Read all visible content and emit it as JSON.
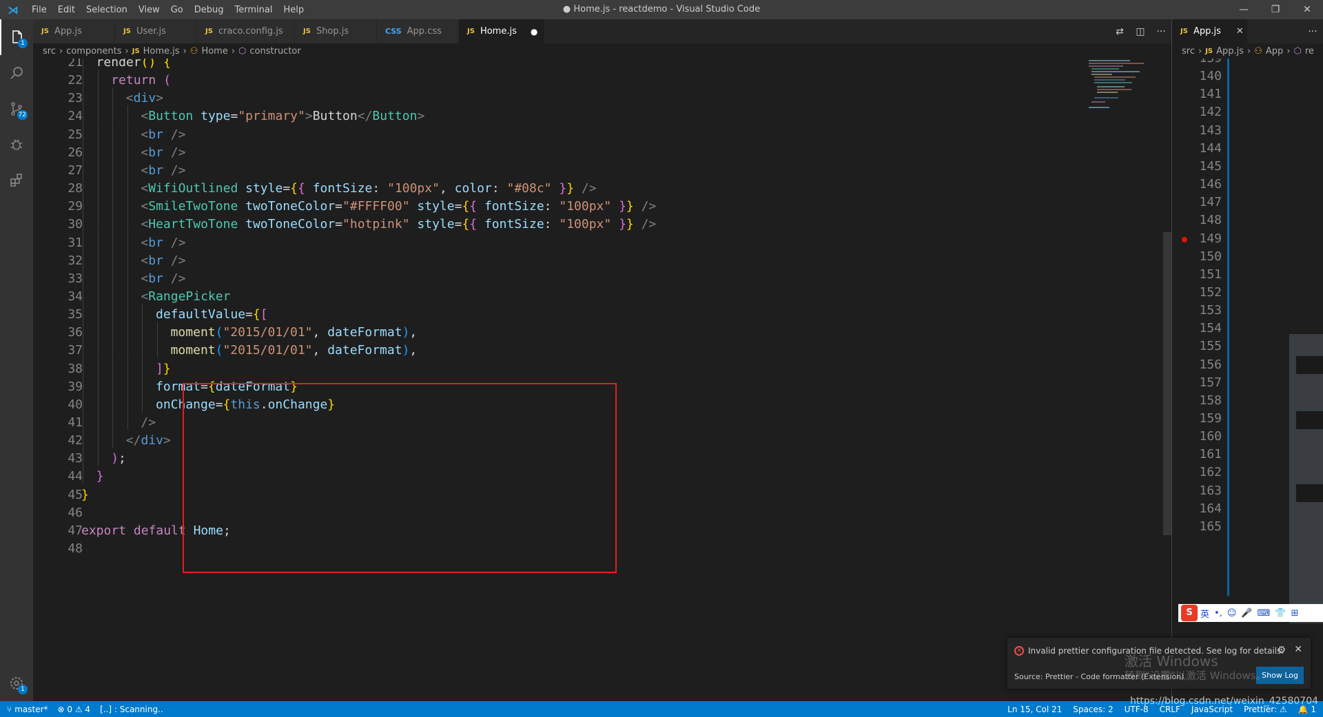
{
  "window": {
    "title": "● Home.js - reactdemo - Visual Studio Code",
    "menu": [
      "File",
      "Edit",
      "Selection",
      "View",
      "Go",
      "Debug",
      "Terminal",
      "Help"
    ]
  },
  "activity_bar": {
    "explorer_badge": "1",
    "scm_badge": "72",
    "settings_badge": "1"
  },
  "group1": {
    "tabs": [
      {
        "icon": "JS",
        "label": "App.js"
      },
      {
        "icon": "JS",
        "label": "User.js"
      },
      {
        "icon": "JS",
        "label": "craco.config.js"
      },
      {
        "icon": "JS",
        "label": "Shop.js"
      },
      {
        "icon": "CSS",
        "label": "App.css"
      },
      {
        "icon": "JS",
        "label": "Home.js",
        "active": true,
        "dirty": "●"
      }
    ],
    "breadcrumb": [
      "src",
      "components",
      "Home.js",
      "Home",
      "constructor"
    ],
    "breadcrumb_js": "JS",
    "lines": [
      {
        "n": "21",
        "indent": 1,
        "tokens": [
          [
            "text",
            "render"
          ],
          [
            "br1",
            "()"
          ],
          [
            "text",
            " "
          ],
          [
            "br1",
            "{"
          ]
        ]
      },
      {
        "n": "22",
        "indent": 2,
        "tokens": [
          [
            "kw",
            "return"
          ],
          [
            "text",
            " "
          ],
          [
            "br2",
            "("
          ]
        ]
      },
      {
        "n": "23",
        "indent": 3,
        "tokens": [
          [
            "punct",
            "<"
          ],
          [
            "tag",
            "div"
          ],
          [
            "punct",
            ">"
          ]
        ]
      },
      {
        "n": "24",
        "indent": 4,
        "tokens": [
          [
            "punct",
            "<"
          ],
          [
            "comp",
            "Button"
          ],
          [
            "text",
            " "
          ],
          [
            "attr",
            "type"
          ],
          [
            "text",
            "="
          ],
          [
            "str",
            "\"primary\""
          ],
          [
            "punct",
            ">"
          ],
          [
            "text",
            "Button"
          ],
          [
            "punct",
            "</"
          ],
          [
            "comp",
            "Button"
          ],
          [
            "punct",
            ">"
          ]
        ]
      },
      {
        "n": "25",
        "indent": 4,
        "tokens": [
          [
            "punct",
            "<"
          ],
          [
            "tag",
            "br"
          ],
          [
            "text",
            " "
          ],
          [
            "punct",
            "/>"
          ]
        ]
      },
      {
        "n": "26",
        "indent": 4,
        "tokens": [
          [
            "punct",
            "<"
          ],
          [
            "tag",
            "br"
          ],
          [
            "text",
            " "
          ],
          [
            "punct",
            "/>"
          ]
        ]
      },
      {
        "n": "27",
        "indent": 4,
        "tokens": [
          [
            "punct",
            "<"
          ],
          [
            "tag",
            "br"
          ],
          [
            "text",
            " "
          ],
          [
            "punct",
            "/>"
          ]
        ]
      },
      {
        "n": "28",
        "indent": 4,
        "tokens": [
          [
            "punct",
            "<"
          ],
          [
            "comp",
            "WifiOutlined"
          ],
          [
            "text",
            " "
          ],
          [
            "attr",
            "style"
          ],
          [
            "text",
            "="
          ],
          [
            "br1",
            "{"
          ],
          [
            "br2",
            "{"
          ],
          [
            "text",
            " "
          ],
          [
            "attr",
            "fontSize"
          ],
          [
            "text",
            ": "
          ],
          [
            "str",
            "\"100px\""
          ],
          [
            "text",
            ", "
          ],
          [
            "attr",
            "color"
          ],
          [
            "text",
            ": "
          ],
          [
            "str",
            "\"#08c\""
          ],
          [
            "text",
            " "
          ],
          [
            "br2",
            "}"
          ],
          [
            "br1",
            "}"
          ],
          [
            "text",
            " "
          ],
          [
            "punct",
            "/>"
          ]
        ]
      },
      {
        "n": "29",
        "indent": 4,
        "tokens": [
          [
            "punct",
            "<"
          ],
          [
            "comp",
            "SmileTwoTone"
          ],
          [
            "text",
            " "
          ],
          [
            "attr",
            "twoToneColor"
          ],
          [
            "text",
            "="
          ],
          [
            "str",
            "\"#FFFF00\""
          ],
          [
            "text",
            " "
          ],
          [
            "attr",
            "style"
          ],
          [
            "text",
            "="
          ],
          [
            "br1",
            "{"
          ],
          [
            "br2",
            "{"
          ],
          [
            "text",
            " "
          ],
          [
            "attr",
            "fontSize"
          ],
          [
            "text",
            ": "
          ],
          [
            "str",
            "\"100px\""
          ],
          [
            "text",
            " "
          ],
          [
            "br2",
            "}"
          ],
          [
            "br1",
            "}"
          ],
          [
            "text",
            " "
          ],
          [
            "punct",
            "/>"
          ]
        ]
      },
      {
        "n": "30",
        "indent": 4,
        "tokens": [
          [
            "punct",
            "<"
          ],
          [
            "comp",
            "HeartTwoTone"
          ],
          [
            "text",
            " "
          ],
          [
            "attr",
            "twoToneColor"
          ],
          [
            "text",
            "="
          ],
          [
            "str",
            "\"hotpink\""
          ],
          [
            "text",
            " "
          ],
          [
            "attr",
            "style"
          ],
          [
            "text",
            "="
          ],
          [
            "br1",
            "{"
          ],
          [
            "br2",
            "{"
          ],
          [
            "text",
            " "
          ],
          [
            "attr",
            "fontSize"
          ],
          [
            "text",
            ": "
          ],
          [
            "str",
            "\"100px\""
          ],
          [
            "text",
            " "
          ],
          [
            "br2",
            "}"
          ],
          [
            "br1",
            "}"
          ],
          [
            "text",
            " "
          ],
          [
            "punct",
            "/>"
          ]
        ]
      },
      {
        "n": "31",
        "indent": 4,
        "tokens": [
          [
            "punct",
            "<"
          ],
          [
            "tag",
            "br"
          ],
          [
            "text",
            " "
          ],
          [
            "punct",
            "/>"
          ]
        ]
      },
      {
        "n": "32",
        "indent": 4,
        "tokens": [
          [
            "punct",
            "<"
          ],
          [
            "tag",
            "br"
          ],
          [
            "text",
            " "
          ],
          [
            "punct",
            "/>"
          ]
        ]
      },
      {
        "n": "33",
        "indent": 4,
        "tokens": [
          [
            "punct",
            "<"
          ],
          [
            "tag",
            "br"
          ],
          [
            "text",
            " "
          ],
          [
            "punct",
            "/>"
          ]
        ]
      },
      {
        "n": "34",
        "indent": 4,
        "tokens": [
          [
            "punct",
            "<"
          ],
          [
            "comp",
            "RangePicker"
          ]
        ]
      },
      {
        "n": "35",
        "indent": 5,
        "tokens": [
          [
            "attr",
            "defaultValue"
          ],
          [
            "text",
            "="
          ],
          [
            "br1",
            "{"
          ],
          [
            "br2",
            "["
          ]
        ]
      },
      {
        "n": "36",
        "indent": 6,
        "tokens": [
          [
            "fn",
            "moment"
          ],
          [
            "br3",
            "("
          ],
          [
            "str",
            "\"2015/01/01\""
          ],
          [
            "text",
            ", "
          ],
          [
            "ident",
            "dateFormat"
          ],
          [
            "br3",
            ")"
          ],
          [
            "text",
            ","
          ]
        ]
      },
      {
        "n": "37",
        "indent": 6,
        "tokens": [
          [
            "fn",
            "moment"
          ],
          [
            "br3",
            "("
          ],
          [
            "str",
            "\"2015/01/01\""
          ],
          [
            "text",
            ", "
          ],
          [
            "ident",
            "dateFormat"
          ],
          [
            "br3",
            ")"
          ],
          [
            "text",
            ","
          ]
        ]
      },
      {
        "n": "38",
        "indent": 5,
        "tokens": [
          [
            "br2",
            "]"
          ],
          [
            "br1",
            "}"
          ]
        ]
      },
      {
        "n": "39",
        "indent": 5,
        "tokens": [
          [
            "attr",
            "format"
          ],
          [
            "text",
            "="
          ],
          [
            "br1",
            "{"
          ],
          [
            "ident",
            "dateFormat"
          ],
          [
            "br1",
            "}"
          ]
        ]
      },
      {
        "n": "40",
        "indent": 5,
        "tokens": [
          [
            "attr",
            "onChange"
          ],
          [
            "text",
            "="
          ],
          [
            "br1",
            "{"
          ],
          [
            "this",
            "this"
          ],
          [
            "text",
            "."
          ],
          [
            "ident",
            "onChange"
          ],
          [
            "br1",
            "}"
          ]
        ]
      },
      {
        "n": "41",
        "indent": 4,
        "tokens": [
          [
            "punct",
            "/>"
          ]
        ]
      },
      {
        "n": "42",
        "indent": 3,
        "tokens": [
          [
            "punct",
            "</"
          ],
          [
            "tag",
            "div"
          ],
          [
            "punct",
            ">"
          ]
        ]
      },
      {
        "n": "43",
        "indent": 2,
        "tokens": [
          [
            "br2",
            ")"
          ],
          [
            "text",
            ";"
          ]
        ]
      },
      {
        "n": "44",
        "indent": 1,
        "tokens": [
          [
            "br2",
            "}"
          ]
        ]
      },
      {
        "n": "45",
        "indent": 0,
        "tokens": [
          [
            "br1",
            "}"
          ]
        ]
      },
      {
        "n": "46",
        "indent": 0,
        "tokens": []
      },
      {
        "n": "47",
        "indent": 0,
        "tokens": [
          [
            "kw",
            "export"
          ],
          [
            "text",
            " "
          ],
          [
            "kw",
            "default"
          ],
          [
            "text",
            " "
          ],
          [
            "ident",
            "Home"
          ],
          [
            "text",
            ";"
          ]
        ]
      },
      {
        "n": "48",
        "indent": 0,
        "tokens": []
      }
    ]
  },
  "group2": {
    "tab": {
      "icon": "JS",
      "label": "App.js"
    },
    "breadcrumb": [
      "src",
      "App.js",
      "App",
      "re"
    ],
    "breadcrumb_js": "JS",
    "line_numbers": [
      "139",
      "140",
      "141",
      "142",
      "143",
      "144",
      "145",
      "146",
      "147",
      "148",
      "149",
      "150",
      "151",
      "152",
      "153",
      "154",
      "155",
      "156",
      "157",
      "158",
      "159",
      "160",
      "161",
      "162",
      "163",
      "164",
      "165"
    ],
    "breakpoint_line": "149"
  },
  "ime": {
    "logo": "S",
    "mode": "英",
    "items": [
      "•,",
      "☺",
      "🎤",
      "⌨",
      "👕",
      "⊞"
    ]
  },
  "notification": {
    "message": "Invalid prettier configuration file detected. See log for details.",
    "source": "Source: Prettier - Code formatter (Extension)",
    "button": "Show Log"
  },
  "watermark": {
    "activate": "激活 Windows",
    "activate_sub": "转到\"设置\"以激活 Windows。",
    "url": "https://blog.csdn.net/weixin_42580704"
  },
  "statusbar": {
    "branch": "master*",
    "problems": "⊗ 0 ⚠ 4",
    "task": "[..] : Scanning..",
    "position": "Ln 15, Col 21",
    "spaces": "Spaces: 2",
    "encoding": "UTF-8",
    "eol": "CRLF",
    "language": "JavaScript",
    "prettier": "Prettier: ⚠",
    "bell": "🔔 1"
  },
  "colors": {
    "accent": "#007acc",
    "highlight_box": "#e0201f",
    "breakpoint": "#e51400"
  }
}
